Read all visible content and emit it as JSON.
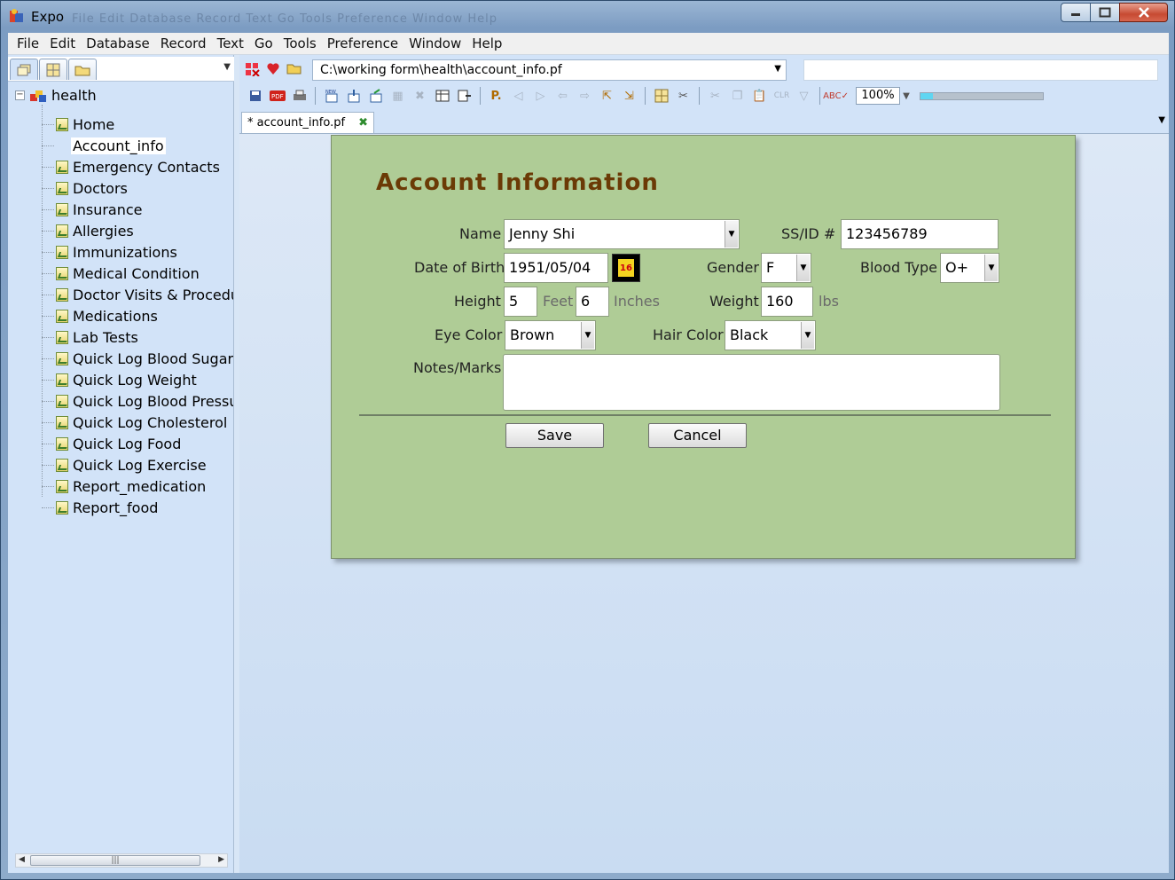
{
  "window": {
    "title": "Expo",
    "title_ghost": "File  Edit  Database  Record  Text  Go  Tools  Preference  Window  Help"
  },
  "menu": [
    "File",
    "Edit",
    "Database",
    "Record",
    "Text",
    "Go",
    "Tools",
    "Preference",
    "Window",
    "Help"
  ],
  "tree": {
    "root": "health",
    "items": [
      "Home",
      "Account_info",
      "Emergency Contacts",
      "Doctors",
      "Insurance",
      "Allergies",
      "Immunizations",
      "Medical Condition",
      "Doctor Visits & Procedur",
      "Medications",
      "Lab Tests",
      "Quick Log Blood Sugar",
      "Quick Log Weight",
      "Quick Log Blood Pressur",
      "Quick Log Cholesterol",
      "Quick Log Food",
      "Quick Log Exercise",
      "Report_medication",
      "Report_food"
    ],
    "selected_index": 1
  },
  "address": {
    "path": "C:\\working form\\health\\account_info.pf",
    "search_value": ""
  },
  "toolbar": {
    "zoom": "100%",
    "zoom_slider_fraction": 0.1
  },
  "doc_tab": {
    "label": "* account_info.pf"
  },
  "form": {
    "title": "Account  Information",
    "labels": {
      "name": "Name",
      "ssid": "SS/ID #",
      "dob": "Date of Birth",
      "gender": "Gender",
      "blood_type": "Blood Type",
      "height": "Height",
      "feet": "Feet",
      "inches": "Inches",
      "weight": "Weight",
      "lbs": "lbs",
      "eye_color": "Eye Color",
      "hair_color": "Hair Color",
      "notes": "Notes/Marks"
    },
    "values": {
      "name": "Jenny Shi",
      "ssid": "123456789",
      "dob": "1951/05/04",
      "calendar_day": "16",
      "gender": "F",
      "blood_type": "O+",
      "height_feet": "5",
      "height_inches": "6",
      "weight": "160",
      "eye_color": "Brown",
      "hair_color": "Black",
      "notes": ""
    },
    "buttons": {
      "save": "Save",
      "cancel": "Cancel"
    }
  },
  "colors": {
    "form_bg": "#afcc96",
    "title_color": "#6b3a06",
    "panel_bg": "#d2e3f8"
  }
}
